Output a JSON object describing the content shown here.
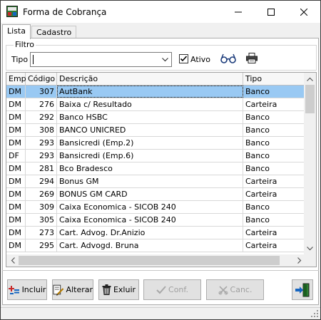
{
  "window": {
    "title": "Forma de Cobrança",
    "controls": {
      "minimize": "minimize-icon",
      "maximize": "maximize-icon",
      "close": "close-icon"
    }
  },
  "tabs": [
    {
      "label": "Lista",
      "active": true
    },
    {
      "label": "Cadastro",
      "active": false
    }
  ],
  "filter": {
    "group_label": "Filtro",
    "tipo_label": "Tipo",
    "tipo_value": "",
    "ativo_label": "Ativo",
    "ativo_checked": true
  },
  "grid": {
    "columns": [
      "Emp",
      "Código",
      "Descrição",
      "Tipo"
    ],
    "selected_index": 0,
    "rows": [
      [
        "DM",
        "307",
        "AutBank",
        "Banco"
      ],
      [
        "DM",
        "276",
        "Baixa c/ Resultado",
        "Carteira"
      ],
      [
        "DM",
        "292",
        "Banco HSBC",
        "Banco"
      ],
      [
        "DM",
        "308",
        "BANCO UNICRED",
        "Banco"
      ],
      [
        "DM",
        "293",
        "Bansicredi (Emp.2)",
        "Banco"
      ],
      [
        "DF",
        "293",
        "Bansicredi (Emp.6)",
        "Banco"
      ],
      [
        "DM",
        "281",
        "Bco Bradesco",
        "Banco"
      ],
      [
        "DM",
        "294",
        "Bonus GM",
        "Carteira"
      ],
      [
        "DM",
        "269",
        "BONUS GM CARD",
        "Carteira"
      ],
      [
        "DM",
        "309",
        "Caixa Economica - SICOB 240",
        "Banco"
      ],
      [
        "DM",
        "305",
        "Caixa Economica - SICOB 240",
        "Banco"
      ],
      [
        "DM",
        "273",
        "Cart. Advog. Dr.Anizio",
        "Carteira"
      ],
      [
        "DM",
        "295",
        "Cart. Advogd. Bruna",
        "Carteira"
      ]
    ]
  },
  "buttons": {
    "incluir": "Incluir",
    "alterar": "Alterar",
    "excluir": "Exluir",
    "conf": "Conf.",
    "canc": "Canc."
  },
  "colors": {
    "selection": "#99c9f3",
    "title_bg": "#ffffff",
    "window_bg": "#f0f0f0"
  }
}
